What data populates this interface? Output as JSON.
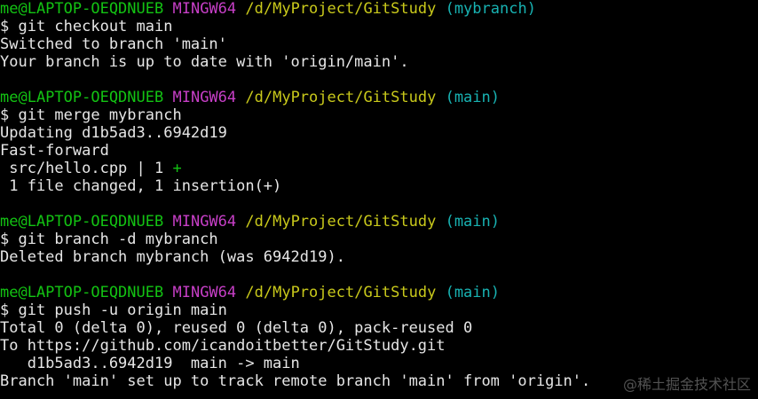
{
  "blocks": [
    {
      "prompt": {
        "user_host": "me@LAPTOP-OEQDNUEB",
        "system": "MINGW64",
        "path": "/d/MyProject/GitStudy",
        "branch": "(mybranch)"
      },
      "command": "$ git checkout main",
      "output": [
        "Switched to branch 'main'",
        "Your branch is up to date with 'origin/main'."
      ]
    },
    {
      "prompt": {
        "user_host": "me@LAPTOP-OEQDNUEB",
        "system": "MINGW64",
        "path": "/d/MyProject/GitStudy",
        "branch": "(main)"
      },
      "command": "$ git merge mybranch",
      "output": [
        "Updating d1b5ad3..6942d19",
        "Fast-forward"
      ],
      "diffstat": {
        "file_line": " src/hello.cpp | 1 ",
        "plus": "+"
      },
      "summary": " 1 file changed, 1 insertion(+)"
    },
    {
      "prompt": {
        "user_host": "me@LAPTOP-OEQDNUEB",
        "system": "MINGW64",
        "path": "/d/MyProject/GitStudy",
        "branch": "(main)"
      },
      "command": "$ git branch -d mybranch",
      "output": [
        "Deleted branch mybranch (was 6942d19)."
      ]
    },
    {
      "prompt": {
        "user_host": "me@LAPTOP-OEQDNUEB",
        "system": "MINGW64",
        "path": "/d/MyProject/GitStudy",
        "branch": "(main)"
      },
      "command": "$ git push -u origin main",
      "output": [
        "Total 0 (delta 0), reused 0 (delta 0), pack-reused 0",
        "To https://github.com/icandoitbetter/GitStudy.git",
        "   d1b5ad3..6942d19  main -> main",
        "Branch 'main' set up to track remote branch 'main' from 'origin'."
      ]
    }
  ],
  "watermark": "@稀土掘金技术社区",
  "colors": {
    "background": "#000000",
    "user_host": "#13c313",
    "system": "#c73fc7",
    "path": "#c9c91b",
    "branch": "#18b2b2",
    "text": "#e6e6e6",
    "diff_plus": "#13c313"
  }
}
